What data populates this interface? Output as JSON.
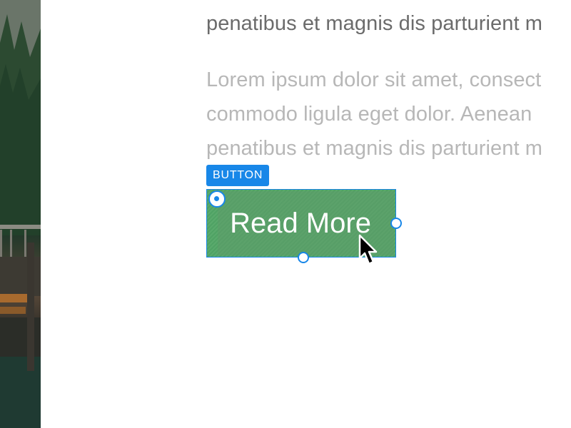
{
  "background_image": {
    "subject": "forest lake with wooden dock"
  },
  "paragraphs": {
    "first_tail": "penatibus et magnis dis parturient m",
    "second_lines": [
      "Lorem ipsum dolor sit amet, consect",
      "commodo ligula eget dolor. Aenean",
      "penatibus et magnis dis parturient m"
    ]
  },
  "selection": {
    "badge_label": "BUTTON",
    "button_label": "Read More",
    "accent_color": "#1887e8",
    "button_color": "#5a9f6b"
  },
  "icons": {
    "cursor": "mouse-pointer-icon",
    "anchor": "anchor-handle-icon",
    "resize": "resize-handle-icon"
  }
}
